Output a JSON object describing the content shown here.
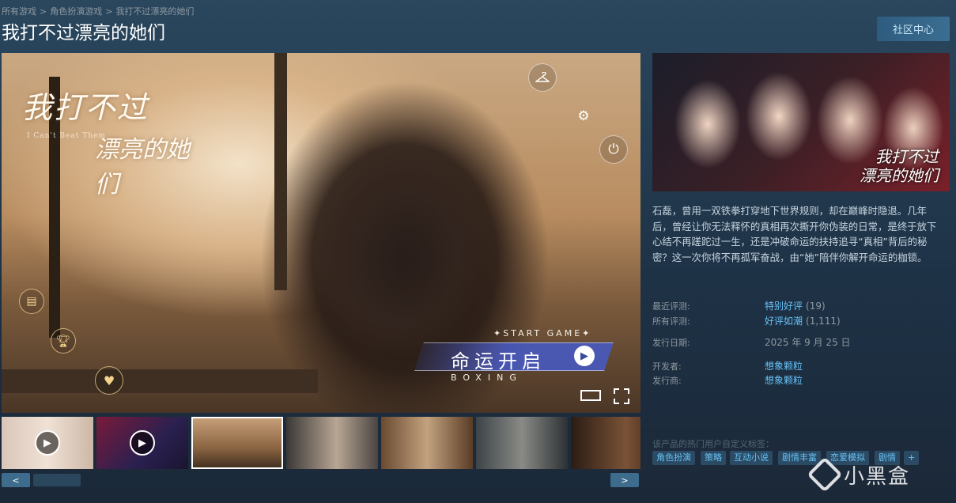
{
  "breadcrumb": {
    "items": [
      "所有游戏",
      "角色扮演游戏",
      "我打不过漂亮的她们"
    ],
    "separator": ">"
  },
  "title": "我打不过漂亮的她们",
  "community_button": "社区中心",
  "main_media": {
    "logo_line1": "我打不过",
    "logo_line2": "漂亮的她们",
    "logo_en": "I Can't Beat Them",
    "start_game_en": "✦START GAME✦",
    "start_game_cn": "命运开启",
    "boxing": "BOXING",
    "icons": [
      "hanger-icon",
      "gear-icon",
      "power-icon",
      "notes-icon",
      "trophy-icon",
      "hearts-icon"
    ],
    "controls": [
      "fullscreen-window-icon",
      "fullscreen-icon"
    ]
  },
  "thumbnails": [
    {
      "kind": "video"
    },
    {
      "kind": "video"
    },
    {
      "kind": "image",
      "selected": true
    },
    {
      "kind": "image"
    },
    {
      "kind": "image"
    },
    {
      "kind": "image"
    },
    {
      "kind": "image"
    }
  ],
  "capsule_title_line1": "我打不过",
  "capsule_title_line2": "漂亮的她们",
  "description": "石磊，曾用一双铁拳打穿地下世界规则，却在巅峰时隐退。几年后，曾经让你无法释怀的真相再次撕开你伪装的日常，是终于放下心结不再蹉跎过一生，还是冲破命运的扶持追寻“真相”背后的秘密？这一次你将不再孤军奋战，由“她”陪伴你解开命运的枷锁。",
  "reviews": {
    "recent_label": "最近评测:",
    "recent_value": "特别好评",
    "recent_count": "(19)",
    "all_label": "所有评测:",
    "all_value": "好评如潮",
    "all_count": "(1,111)"
  },
  "release": {
    "label": "发行日期:",
    "value": "2025 年 9 月 25 日"
  },
  "developer": {
    "label": "开发者:",
    "value": "想象颗粒"
  },
  "publisher": {
    "label": "发行商:",
    "value": "想象颗粒"
  },
  "tags_label": "该产品的热门用户自定义标签：",
  "tags": [
    "角色扮演",
    "策略",
    "互动小说",
    "剧情丰富",
    "恋爱模拟",
    "剧情",
    "+"
  ],
  "watermark_text": "小黑盒",
  "colors": {
    "link": "#66c0f4",
    "muted": "#8f98a0",
    "tag_bg": "#2b4a63",
    "button": "#3b6e92"
  }
}
